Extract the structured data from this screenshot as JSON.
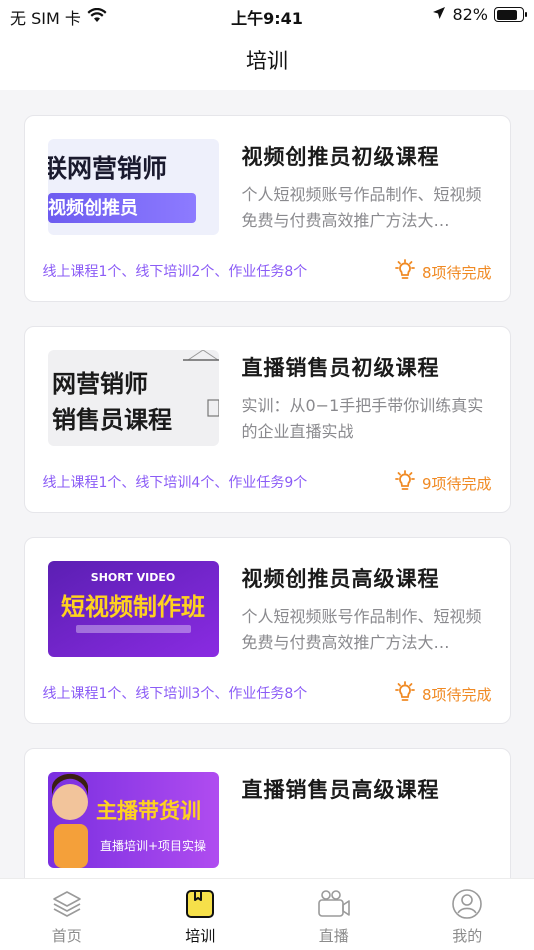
{
  "status_bar": {
    "carrier": "无 SIM 卡",
    "time": "上午9:41",
    "battery": "82%",
    "battery_level": 0.82
  },
  "header": {
    "title": "培训"
  },
  "courses": [
    {
      "title": "视频创推员初级课程",
      "description": "个人短视频账号作品制作、短视频免费与付费高效推广方法大…",
      "thumb_text_1": "联网营销师",
      "thumb_text_2": "视频创推员",
      "meta": "线上课程1个、线下培训2个、作业任务8个",
      "pending": "8项待完成"
    },
    {
      "title": "直播销售员初级课程",
      "description": "实训：从0−1手把手带你训练真实的企业直播实战",
      "thumb_text_1": "网营销师",
      "thumb_text_2": "销售员课程",
      "meta": "线上课程1个、线下培训4个、作业任务9个",
      "pending": "9项待完成"
    },
    {
      "title": "视频创推员高级课程",
      "description": "个人短视频账号作品制作、短视频免费与付费高效推广方法大…",
      "thumb_text_1": "SHORT VIDEO",
      "thumb_text_2": "短视频制作班",
      "meta": "线上课程1个、线下培训3个、作业任务8个",
      "pending": "8项待完成"
    },
    {
      "title": "直播销售员高级课程",
      "description": "",
      "thumb_text_1": "主播带货训",
      "thumb_text_2": "直播培训+项目实操",
      "meta": "",
      "pending": ""
    }
  ],
  "tabs": [
    {
      "label": "首页",
      "icon": "layers-icon"
    },
    {
      "label": "培训",
      "icon": "training-book-icon",
      "active": true
    },
    {
      "label": "直播",
      "icon": "video-camera-icon"
    },
    {
      "label": "我的",
      "icon": "user-icon"
    }
  ],
  "colors": {
    "accent_purple": "#8b5cf6",
    "pending_orange": "#f08a24",
    "active_tab_yellow": "#f6e04a"
  }
}
